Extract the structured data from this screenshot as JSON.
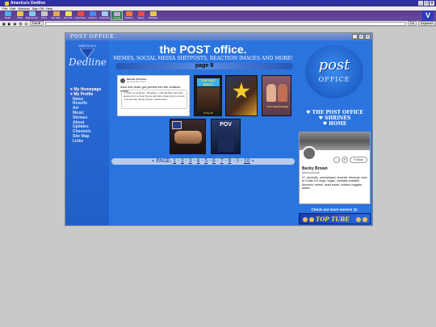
{
  "window": {
    "title": "America's Dedline"
  },
  "menubar": [
    "File",
    "Edit",
    "Window",
    "Sign Off",
    "Help"
  ],
  "toolbar": {
    "items": [
      {
        "label": "Read",
        "color": "#4ab0e8"
      },
      {
        "label": "Write",
        "color": "#e8c84a"
      },
      {
        "label": "Mail Center",
        "color": "#7ad0e8"
      },
      {
        "label": "Print",
        "color": "#c8c8c8"
      },
      {
        "label": "My Files",
        "color": "#e8a84a"
      },
      {
        "label": "My AOL",
        "color": "#e8e84a"
      },
      {
        "label": "Favorites",
        "color": "#e84a4a"
      },
      {
        "label": "Internet",
        "color": "#4a8ae8"
      },
      {
        "label": "Channels",
        "color": "#9ad0e8"
      },
      {
        "label": "People",
        "color": "#c8a8e8"
      },
      {
        "label": "Quotes",
        "color": "#f07a30"
      },
      {
        "label": "Perks",
        "color": "#e84a4a"
      },
      {
        "label": "Weather",
        "color": "#e8c84a"
      }
    ],
    "active_index": 9
  },
  "navbar": {
    "favorites_label": "Fav▼",
    "go_label": "Go",
    "keyword_label": "Keyword"
  },
  "site": {
    "brand": "POST OFFICE.",
    "sidebar": {
      "small_text": "AMERICA'S",
      "script_text": "Dedline",
      "menu": [
        "My Homepage",
        "My Profile",
        "News",
        "Results",
        "Art",
        "Music",
        "Shrines",
        "About",
        "Updates",
        "Channels",
        "Site Map",
        "Links"
      ],
      "highlighted": [
        0,
        1
      ]
    },
    "main": {
      "title": "the POST office.",
      "subtitle": "MEMES, SOCIAL MEDIA SHITPOSTS, REACTION IMAGES AND MORE!",
      "page_label": "page 9",
      "tweet": {
        "name": "Moistin Thornton",
        "handle": "@moistinthornton",
        "text": "wow this dude got yeeted into the shadow realm",
        "quote": "↳ KVIA Local News · Breaking: a Florida Man has been ejected from a local theme park after attempting to board a closed ride during routine maintenance"
      },
      "thumb1": {
        "top": "TOP GOT SHOT!",
        "bottom": "GIVE UP"
      },
      "thumb3": {
        "caption": "Your Liked Feeling"
      },
      "thumb5": {
        "text": "POV"
      },
      "pager": {
        "prefix": "« PAGE:",
        "pages": [
          "1",
          "2",
          "3",
          "4",
          "5",
          "6",
          "7",
          "8",
          "9",
          "10"
        ],
        "current": "9",
        "suffix": "»"
      }
    },
    "right": {
      "logo_post": "post",
      "logo_office": "OFFICE",
      "links": [
        "♥ THE POST OFFICE",
        "♥ SHRINES",
        "♥ HOME"
      ],
      "profile": {
        "name": "Becky Brown",
        "handle": "@beckybrown",
        "bio": "47, alcoholic, unemployed, arsonist, bisexual, mum to 3 kids, 8.5 dogs, vegan, mentally unstable, divorced, retired, dead inside, chicken nuggets addict.",
        "follow_label": "Follow"
      },
      "more_text": "Check out more memes @:",
      "banner_text": "TOP TUBE"
    }
  }
}
